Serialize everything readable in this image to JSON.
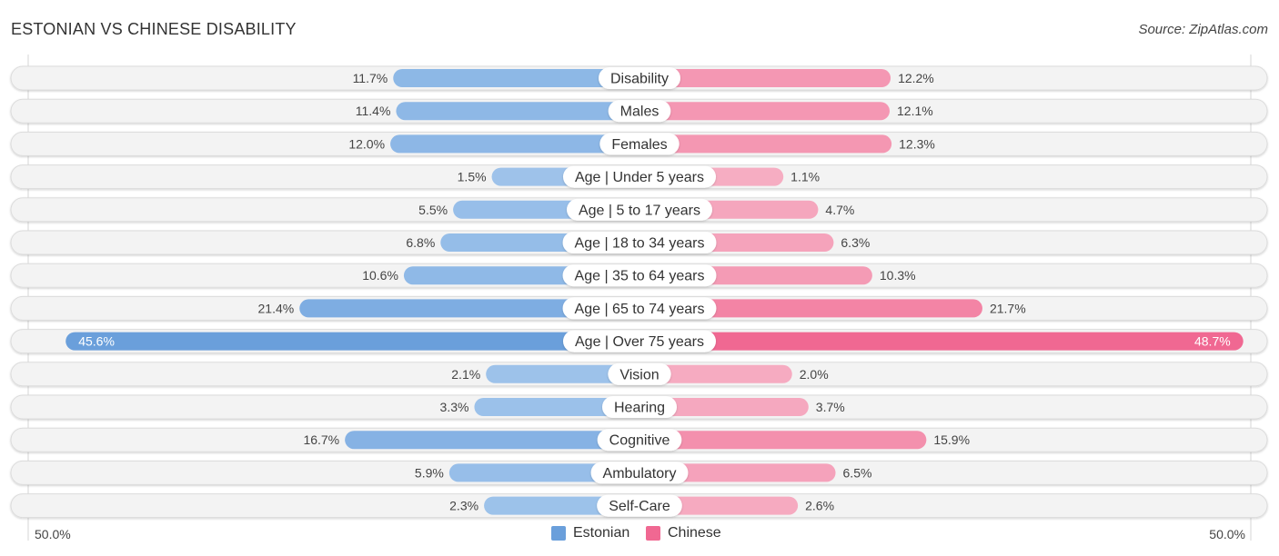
{
  "title": "ESTONIAN VS CHINESE DISABILITY",
  "source": "Source: ZipAtlas.com",
  "axis": {
    "left_label": "50.0%",
    "right_label": "50.0%"
  },
  "legend": [
    {
      "name": "Estonian",
      "color": "#6a9fdb"
    },
    {
      "name": "Chinese",
      "color": "#f06892"
    }
  ],
  "chart_data": {
    "type": "bar",
    "orientation": "horizontal-diverging",
    "title": "ESTONIAN VS CHINESE DISABILITY",
    "xlabel": "",
    "ylabel": "",
    "xlim": [
      -50,
      50
    ],
    "legend_position": "bottom-center",
    "categories": [
      "Disability",
      "Males",
      "Females",
      "Age | Under 5 years",
      "Age | 5 to 17 years",
      "Age | 18 to 34 years",
      "Age | 35 to 64 years",
      "Age | 65 to 74 years",
      "Age | Over 75 years",
      "Vision",
      "Hearing",
      "Cognitive",
      "Ambulatory",
      "Self-Care"
    ],
    "series": [
      {
        "name": "Estonian",
        "side": "left",
        "color": "#6a9fdb",
        "values": [
          11.7,
          11.4,
          12.0,
          1.5,
          5.5,
          6.8,
          10.6,
          21.4,
          45.6,
          2.1,
          3.3,
          16.7,
          5.9,
          2.3
        ],
        "labels": [
          "11.7%",
          "11.4%",
          "12.0%",
          "1.5%",
          "5.5%",
          "6.8%",
          "10.6%",
          "21.4%",
          "45.6%",
          "2.1%",
          "3.3%",
          "16.7%",
          "5.9%",
          "2.3%"
        ]
      },
      {
        "name": "Chinese",
        "side": "right",
        "color": "#f06892",
        "values": [
          12.2,
          12.1,
          12.3,
          1.1,
          4.7,
          6.3,
          10.3,
          21.7,
          48.7,
          2.0,
          3.7,
          15.9,
          6.5,
          2.6
        ],
        "labels": [
          "12.2%",
          "12.1%",
          "12.3%",
          "1.1%",
          "4.7%",
          "6.3%",
          "10.3%",
          "21.7%",
          "48.7%",
          "2.0%",
          "3.7%",
          "15.9%",
          "6.5%",
          "2.6%"
        ]
      }
    ]
  }
}
